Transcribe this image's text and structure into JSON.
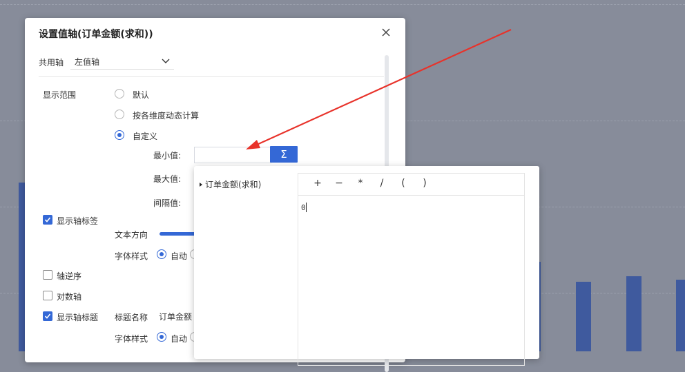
{
  "dialog": {
    "title": "设置值轴(订单金额(求和))",
    "shared_axis": {
      "label": "共用轴",
      "selected": "左值轴"
    },
    "display_range": {
      "label": "显示范围",
      "options": [
        "默认",
        "按各维度动态计算",
        "自定义"
      ],
      "selected_index": 2,
      "min_label": "最小值:",
      "max_label": "最大值:",
      "interval_label": "间隔值:",
      "formula_button": "Σ"
    },
    "show_axis_label": {
      "label": "显示轴标签",
      "checked": true
    },
    "text_direction_label": "文本方向",
    "font_style_label": "字体样式",
    "font_style_auto": "自动",
    "axis_reverse": {
      "label": "轴逆序",
      "checked": false
    },
    "log_axis": {
      "label": "对数轴",
      "checked": false
    },
    "show_axis_title": {
      "label": "显示轴标题",
      "checked": true
    },
    "title_name_label": "标题名称",
    "title_name_value": "订单金额",
    "font_style_label_2": "字体样式",
    "font_style_auto_2": "自动"
  },
  "formula_popup": {
    "fields": [
      "订单金额(求和)"
    ],
    "operators": [
      "+",
      "−",
      "*",
      "/",
      "(",
      ")"
    ],
    "formula": "0"
  },
  "colors": {
    "accent": "#3468d6",
    "annotation_arrow": "#e8322a",
    "bars": "#3f5a9e"
  }
}
